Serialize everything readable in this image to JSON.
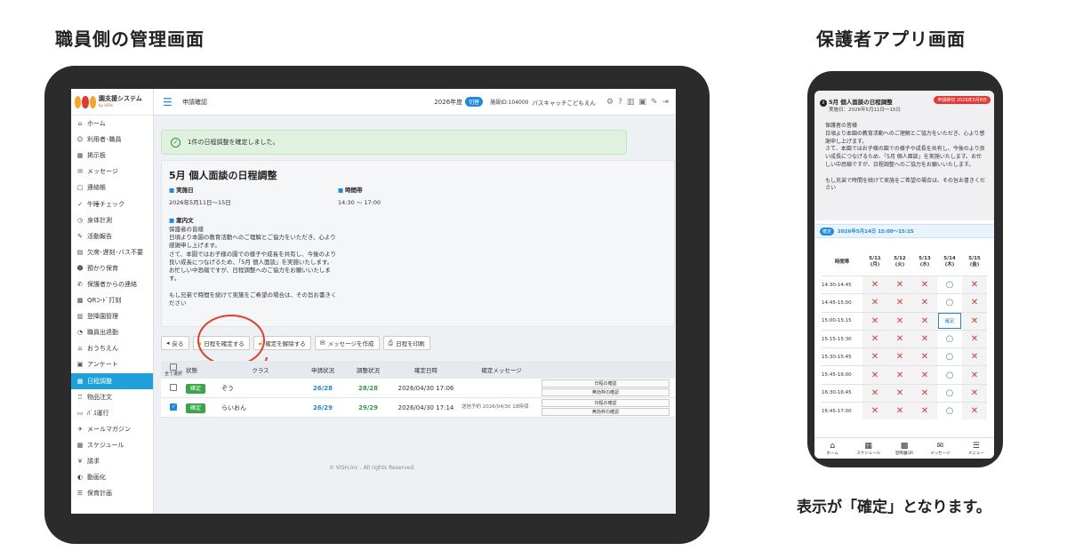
{
  "headings": {
    "staff": "職員側の管理画面",
    "parent": "保護者アプリ画面",
    "caption": "表示が「確定」となります。"
  },
  "admin": {
    "logo": {
      "name": "園支援システム",
      "sub": "by VISH"
    },
    "sidebar": [
      {
        "icon": "home-icon",
        "glyph": "⌂",
        "label": "ホーム"
      },
      {
        "icon": "users-icon",
        "glyph": "☺",
        "label": "利用者･職員"
      },
      {
        "icon": "board-icon",
        "glyph": "▦",
        "label": "掲示板"
      },
      {
        "icon": "mail-icon",
        "glyph": "✉",
        "label": "メッセージ"
      },
      {
        "icon": "calendar-icon",
        "glyph": "□",
        "label": "連絡帳"
      },
      {
        "icon": "check-icon",
        "glyph": "✓",
        "label": "午睡チェック"
      },
      {
        "icon": "scale-icon",
        "glyph": "◷",
        "label": "身体計測"
      },
      {
        "icon": "activity-icon",
        "glyph": "✎",
        "label": "活動報告"
      },
      {
        "icon": "absence-icon",
        "glyph": "▤",
        "label": "欠席･遅刻･バス不要"
      },
      {
        "icon": "child-icon",
        "glyph": "☻",
        "label": "預かり保育"
      },
      {
        "icon": "contact-icon",
        "glyph": "✆",
        "label": "保護者からの連絡"
      },
      {
        "icon": "qr-icon",
        "glyph": "▩",
        "label": "QRｺｰﾄﾞ打刻"
      },
      {
        "icon": "attendance-icon",
        "glyph": "▥",
        "label": "登降園管理"
      },
      {
        "icon": "clock-icon",
        "glyph": "◔",
        "label": "職員出退勤"
      },
      {
        "icon": "house-icon",
        "glyph": "⌂",
        "label": "おうちえん"
      },
      {
        "icon": "survey-icon",
        "glyph": "▣",
        "label": "アンケート"
      },
      {
        "icon": "schedule-adjust-icon",
        "glyph": "▦",
        "label": "日程調整"
      },
      {
        "icon": "cart-icon",
        "glyph": "♖",
        "label": "物品注文"
      },
      {
        "icon": "bus-icon",
        "glyph": "▭",
        "label": "ﾊﾞｽ運行"
      },
      {
        "icon": "magazine-icon",
        "glyph": "✈",
        "label": "メールマガジン"
      },
      {
        "icon": "schedule-icon",
        "glyph": "▦",
        "label": "スケジュール"
      },
      {
        "icon": "yen-icon",
        "glyph": "¥",
        "label": "請求"
      },
      {
        "icon": "digital-icon",
        "glyph": "◐",
        "label": "動画化"
      },
      {
        "icon": "plan-icon",
        "glyph": "☰",
        "label": "保育計画"
      }
    ],
    "active_index": 16,
    "topbar": {
      "title": "申請確認",
      "year": "2026年度",
      "switch_label": "切替",
      "facility_id": "施設ID:104000",
      "school": "パスキャッチこどもえん"
    },
    "success_message": "1件の日程調整を確定しました。",
    "event": {
      "title": "5月 個人面談の日程調整",
      "date_label": "実施日",
      "date_value": "2026年5月11日～15日",
      "time_label": "時間帯",
      "time_value": "14:30 ～ 17:00",
      "notice_label": "案内文",
      "notice_body": "保護者の皆様\n日頃より本園の教育活動へのご理解とご協力をいただき、心より感謝申し上げます。\nさて、本園ではお子様の園での様子や成長を共有し、今後のより良い成長につなげるため、「5月 個人面談」を実施いたします。お忙しい中恐縮ですが、日程調整へのご協力をお願いいたします。\n\nもし兄弟で時間を続けて実施をご希望の場合は、その旨お書きください"
    },
    "toolbar": {
      "back": "戻る",
      "confirm": "日程を確定する",
      "unconfirm": "確定を解除する",
      "message": "メッセージを作成",
      "print": "日程を印刷"
    },
    "table": {
      "headers": {
        "select_all": "全て選択",
        "status": "状態",
        "class": "クラス",
        "request": "申請状況",
        "adjust": "調整状況",
        "date": "確定日時",
        "message": "確定メッセージ"
      },
      "rows": [
        {
          "checked": false,
          "status": "確定",
          "class": "ぞう",
          "request": "26/28",
          "adjust": "28/28",
          "date": "2026/04/30 17:06",
          "message": "",
          "action1": "日程の確認",
          "action2": "無効枠の確認"
        },
        {
          "checked": true,
          "status": "確定",
          "class": "らいおん",
          "request": "26/29",
          "adjust": "29/29",
          "date": "2026/04/30 17:14",
          "message": "送信予約 2026/04/30 18時頃",
          "action1": "日程の確認",
          "action2": "無効枠の確認"
        }
      ]
    },
    "copyright": "© VISH,Inc . All rights Reserved."
  },
  "phone": {
    "title": "5月 個人面談の日程調整",
    "deadline": "申請締切 2026年5月8日",
    "date": "実施日：2026年5月11日～15日",
    "body": "保護者の皆様\n日頃より本園の教育活動へのご理解とご協力をいただき、心より感謝申し上げます。\nさて、本園ではお子様の園での様子や成長を共有し、今後のより良い成長につなげるため、「5月 個人面談」を実施いたします。お忙しい中恐縮ですが、日程調整へのご協力をお願いいたします。\n\nもし兄弟で時間を続けて実施をご希望の場合は、その旨お書きください",
    "confirm_badge": "確定",
    "confirm_text": "2026年5月14日 15:00～15:15",
    "grid": {
      "time_header": "時間帯",
      "days": [
        {
          "date": "5/11",
          "dow": "(月)"
        },
        {
          "date": "5/12",
          "dow": "(火)"
        },
        {
          "date": "5/13",
          "dow": "(水)"
        },
        {
          "date": "5/14",
          "dow": "(木)"
        },
        {
          "date": "5/15",
          "dow": "(金)"
        }
      ],
      "rows": [
        {
          "time": "14:30-14:45",
          "cells": [
            "x",
            "x",
            "x",
            "o",
            "x"
          ]
        },
        {
          "time": "14:45-15:00",
          "cells": [
            "x",
            "x",
            "x",
            "o",
            "x"
          ]
        },
        {
          "time": "15:00-15:15",
          "cells": [
            "x",
            "x",
            "x",
            "c",
            "x"
          ]
        },
        {
          "time": "15:15-15:30",
          "cells": [
            "x",
            "x",
            "x",
            "o",
            "x"
          ]
        },
        {
          "time": "15:30-15:45",
          "cells": [
            "x",
            "x",
            "x",
            "o",
            "x"
          ]
        },
        {
          "time": "15:45-16:00",
          "cells": [
            "x",
            "x",
            "x",
            "o",
            "x"
          ]
        },
        {
          "time": "16:30-16:45",
          "cells": [
            "x",
            "x",
            "x",
            "o",
            "x"
          ]
        },
        {
          "time": "16:45-17:00",
          "cells": [
            "x",
            "x",
            "x",
            "o",
            "x"
          ]
        }
      ],
      "confirm_cell_label": "確定"
    },
    "nav": [
      {
        "icon": "home-icon",
        "glyph": "⌂",
        "label": "ホーム"
      },
      {
        "icon": "schedule-icon",
        "glyph": "▦",
        "label": "スケジュール"
      },
      {
        "icon": "qr-icon",
        "glyph": "▩",
        "label": "登降園QR"
      },
      {
        "icon": "mail-icon",
        "glyph": "✉",
        "label": "メッセージ"
      },
      {
        "icon": "menu-icon",
        "glyph": "☰",
        "label": "メニュー"
      }
    ]
  },
  "colors": {
    "accent": "#1e88e5",
    "confirm_green": "#3aa64a",
    "highlight_red": "#e8392c",
    "sidebar_active": "#20a0d8"
  }
}
